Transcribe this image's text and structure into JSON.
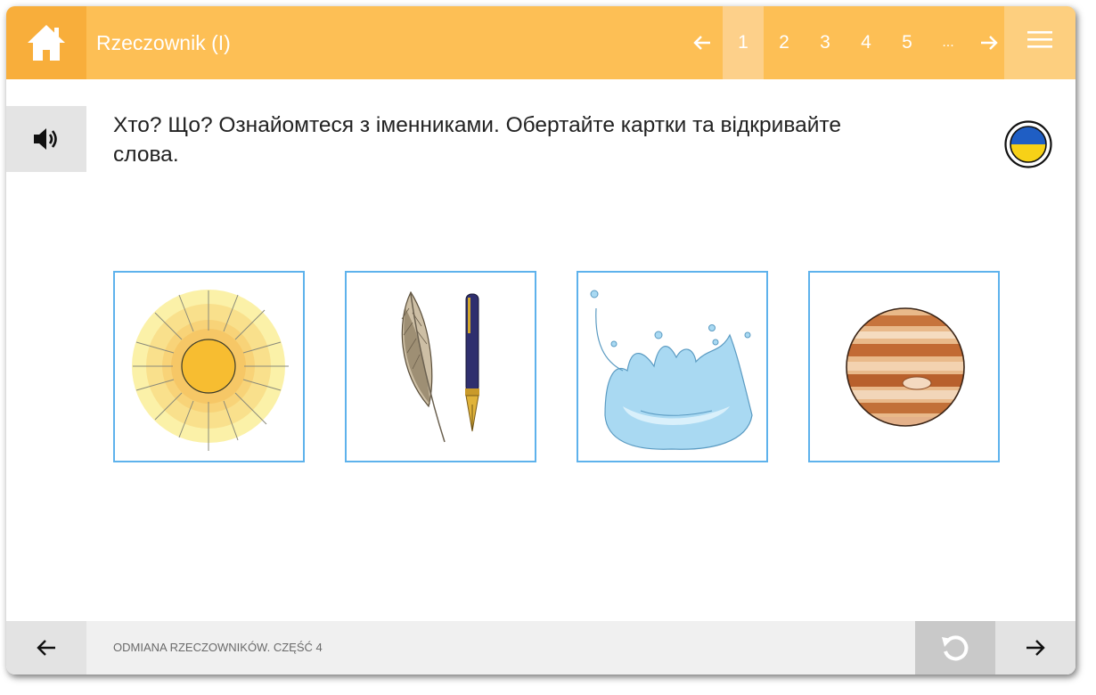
{
  "header": {
    "title": "Rzeczownik (I)",
    "home_icon": "home-icon",
    "menu_icon": "hamburger-menu-icon",
    "pager": {
      "prev_icon": "arrow-left-icon",
      "next_icon": "arrow-right-icon",
      "pages": [
        "1",
        "2",
        "3",
        "4",
        "5",
        "..."
      ],
      "current": "1"
    }
  },
  "content": {
    "audio_icon": "speaker-icon",
    "instruction": "Хто? Що? Ознайомтеся з іменниками. Обертайте картки та відкривайте слова.",
    "language_flag": "ukraine-flag-icon",
    "cards": [
      {
        "image": "sun-image"
      },
      {
        "image": "feather-and-pen-image"
      },
      {
        "image": "water-splash-image"
      },
      {
        "image": "planet-jupiter-image"
      }
    ]
  },
  "footer": {
    "label": "ODMIANA RZECZOWNIKÓW. CZĘŚĆ 4",
    "prev_icon": "arrow-left-icon",
    "reset_icon": "reset-icon",
    "next_icon": "arrow-right-icon"
  },
  "colors": {
    "header": "#fdbf55",
    "card_border": "#5eb2ec",
    "footer": "#f0f0f0"
  }
}
